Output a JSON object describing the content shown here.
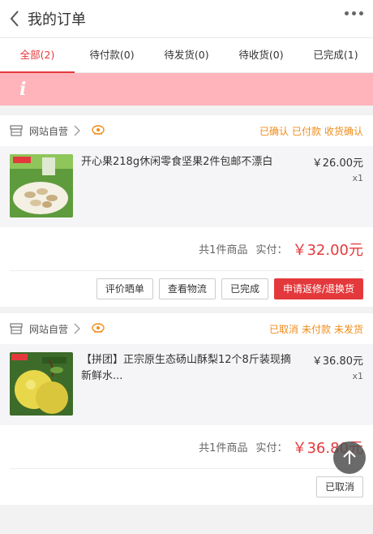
{
  "header": {
    "title": "我的订单",
    "back_icon": "chevron-left-icon",
    "more_icon": "more-dots-icon"
  },
  "tabs": [
    {
      "label": "全部(2)",
      "active": true
    },
    {
      "label": "待付款(0)",
      "active": false
    },
    {
      "label": "待发货(0)",
      "active": false
    },
    {
      "label": "待收货(0)",
      "active": false
    },
    {
      "label": "已完成(1)",
      "active": false
    }
  ],
  "notice": {
    "icon_text": "i",
    "color": "#ffb3ba"
  },
  "orders": [
    {
      "shop_name": "网站自营",
      "status": [
        "已确认",
        "已付款",
        "收货确认"
      ],
      "product": {
        "name": "开心果218g休闲零食坚果2件包邮不漂白",
        "price": "￥26.00元",
        "qty": "x1"
      },
      "summary": {
        "count": "共1件商品",
        "paid_label": "实付：",
        "amount": "￥32.00元"
      },
      "actions": [
        "评价晒单",
        "查看物流",
        "已完成",
        "申请返修/退换货"
      ]
    },
    {
      "shop_name": "网站自营",
      "status": [
        "已取消",
        "未付款",
        "未发货"
      ],
      "product": {
        "name": "【拼团】正宗原生态砀山酥梨12个8斤装现摘新鲜水...",
        "price": "￥36.80元",
        "qty": "x1"
      },
      "summary": {
        "count": "共1件商品",
        "paid_label": "实付：",
        "amount": "￥36.80元"
      },
      "actions": [
        "已取消"
      ]
    }
  ],
  "colors": {
    "accent": "#e4393c",
    "status": "#f08c19"
  }
}
